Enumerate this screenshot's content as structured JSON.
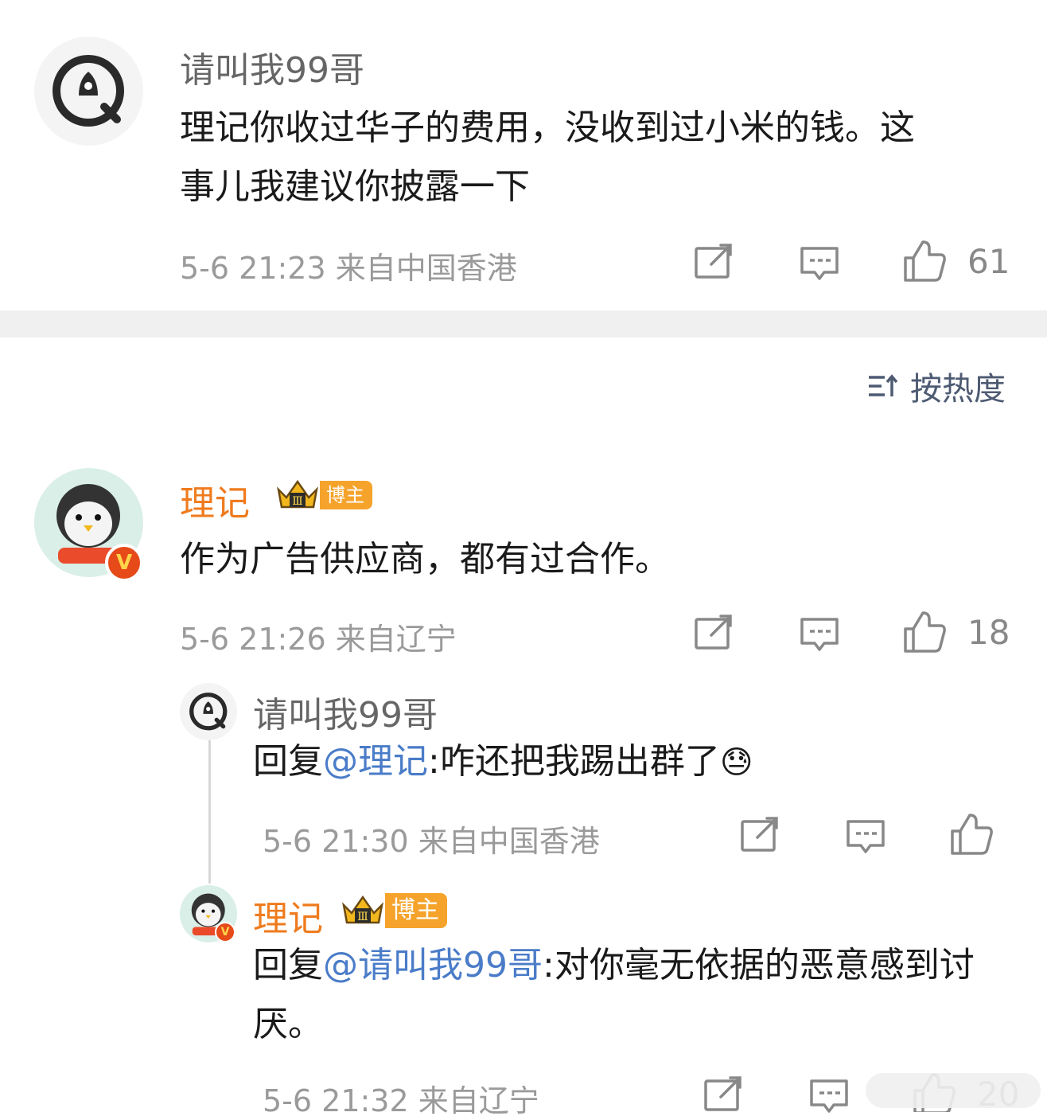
{
  "comments": [
    {
      "user": "请叫我99哥",
      "text": "理记你收过华子的费用，没收到过小米的钱。这事儿我建议你披露一下",
      "meta": "5-6 21:23 来自中国香港",
      "likes": "61"
    }
  ],
  "sort": {
    "label": "按热度",
    "icon": "sort-icon"
  },
  "main": {
    "user": "理记",
    "badge": "博主",
    "text": "作为广告供应商，都有过合作。",
    "meta": "5-6 21:26 来自辽宁",
    "likes": "18",
    "replies": [
      {
        "user": "请叫我99哥",
        "reply_prefix": "回复",
        "mention": "@理记",
        "text": ":咋还把我踢出群了",
        "emoji": "😓",
        "meta": "5-6 21:30 来自中国香港"
      },
      {
        "user": "理记",
        "badge": "博主",
        "reply_prefix": "回复",
        "mention": "@请叫我99哥",
        "text": ":对你毫无依据的恶意感到讨厌。",
        "meta": "5-6 21:32 来自辽宁",
        "likes": "20"
      }
    ]
  },
  "colors": {
    "accent": "#ef7b1e",
    "link": "#4a7cc8",
    "meta": "#9a9a9a"
  }
}
